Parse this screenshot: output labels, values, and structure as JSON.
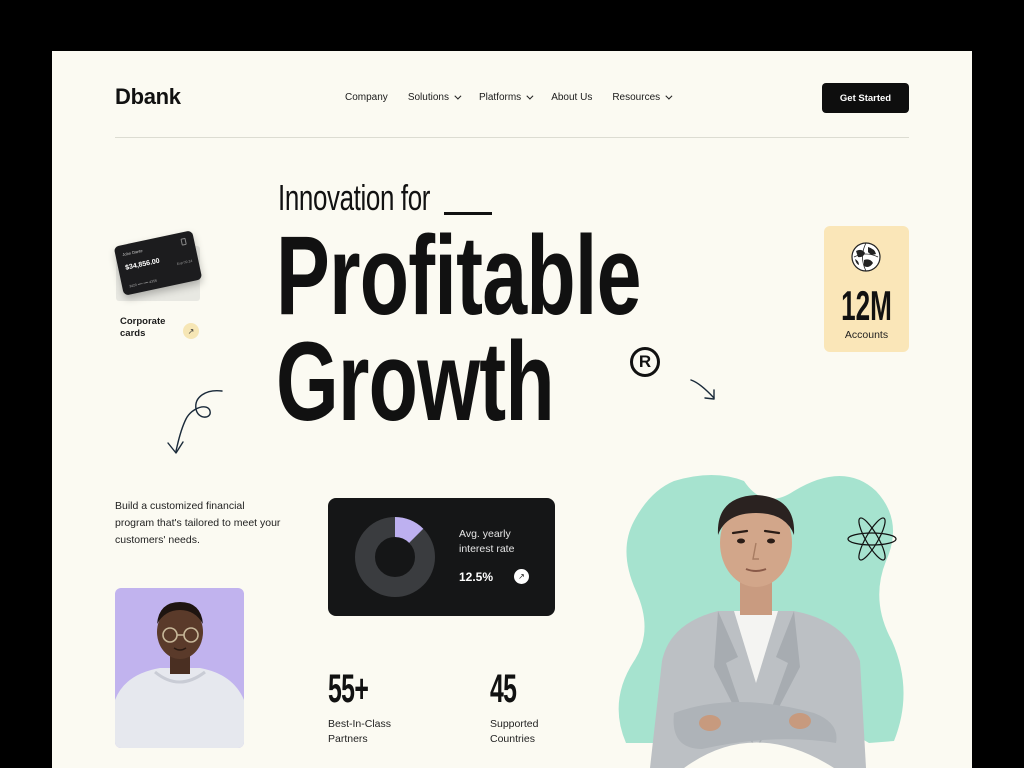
{
  "header": {
    "logo": "Dbank",
    "nav": [
      {
        "label": "Company",
        "dropdown": false
      },
      {
        "label": "Solutions",
        "dropdown": true
      },
      {
        "label": "Platforms",
        "dropdown": true
      },
      {
        "label": "About Us",
        "dropdown": false
      },
      {
        "label": "Resources",
        "dropdown": true
      }
    ],
    "cta_label": "Get Started"
  },
  "hero": {
    "kicker": "Innovation for",
    "headline_line1": "Profitable",
    "headline_line2": "Growth",
    "registered_mark": "R"
  },
  "card_widget": {
    "card_holder": "John Dante",
    "card_amount": "$34,856.00",
    "card_number": "3420 •••• •••• 4356",
    "card_expiry": "Exp 09.24",
    "label": "Corporate cards"
  },
  "accounts": {
    "value": "12M",
    "label": "Accounts"
  },
  "description": "Build a customized financial program that's tailored to meet your customers' needs.",
  "interest": {
    "title": "Avg. yearly interest rate",
    "value": "12.5%",
    "fraction": 0.125
  },
  "stats": [
    {
      "value": "55+",
      "label_line1": "Best-In-Class",
      "label_line2": "Partners"
    },
    {
      "value": "45",
      "label_line1": "Supported",
      "label_line2": "Countries"
    }
  ],
  "colors": {
    "background": "#fbfaf2",
    "accent_mint": "#a6e3cf",
    "accent_purple": "#c1b3ee",
    "accent_yellow": "#fae6b8",
    "dark": "#151617"
  },
  "icons": [
    "chevron-down-icon",
    "arrow-up-right-icon",
    "curly-arrow-icon",
    "arrow-down-right-icon",
    "globe-icon",
    "star-burst-icon"
  ]
}
